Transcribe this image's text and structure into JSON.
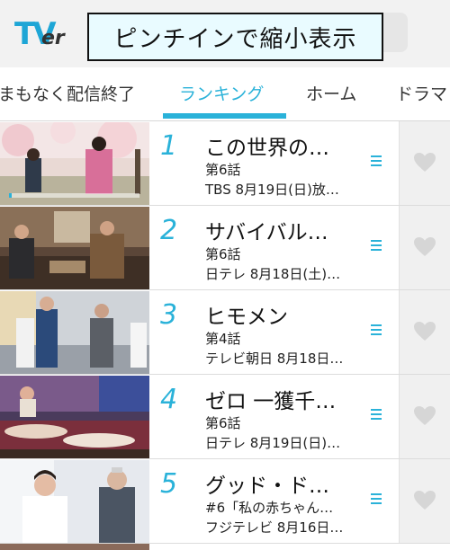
{
  "header": {
    "logo_text": "TVer",
    "caption": "ピンチインで縮小表示"
  },
  "tabs": [
    {
      "label": "まもなく配信終了",
      "active": false
    },
    {
      "label": "ランキング",
      "active": true
    },
    {
      "label": "ホーム",
      "active": false
    },
    {
      "label": "ドラマ",
      "active": false
    }
  ],
  "colors": {
    "accent": "#2ab2d9",
    "favorite_bg": "#f0f0f0",
    "heart": "#d6d6d6"
  },
  "rankings": [
    {
      "rank": "1",
      "title": "この世界の…",
      "episode": "第6話",
      "broadcast": "TBS  8月19日(日)放…",
      "progress": 0.02
    },
    {
      "rank": "2",
      "title": "サバイバル…",
      "episode": "第6話",
      "broadcast": "日テレ  8月18日(土)…"
    },
    {
      "rank": "3",
      "title": "ヒモメン",
      "episode": "第4話",
      "broadcast": "テレビ朝日  8月18日…"
    },
    {
      "rank": "4",
      "title": "ゼロ 一獲千…",
      "episode": "第6話",
      "broadcast": "日テレ  8月19日(日)…"
    },
    {
      "rank": "5",
      "title": "グッド・ド…",
      "episode": "#6「私の赤ちゃん…",
      "broadcast": "フジテレビ  8月16日…"
    }
  ],
  "icons": {
    "menu": "list-menu-icon",
    "favorite": "heart-icon"
  }
}
